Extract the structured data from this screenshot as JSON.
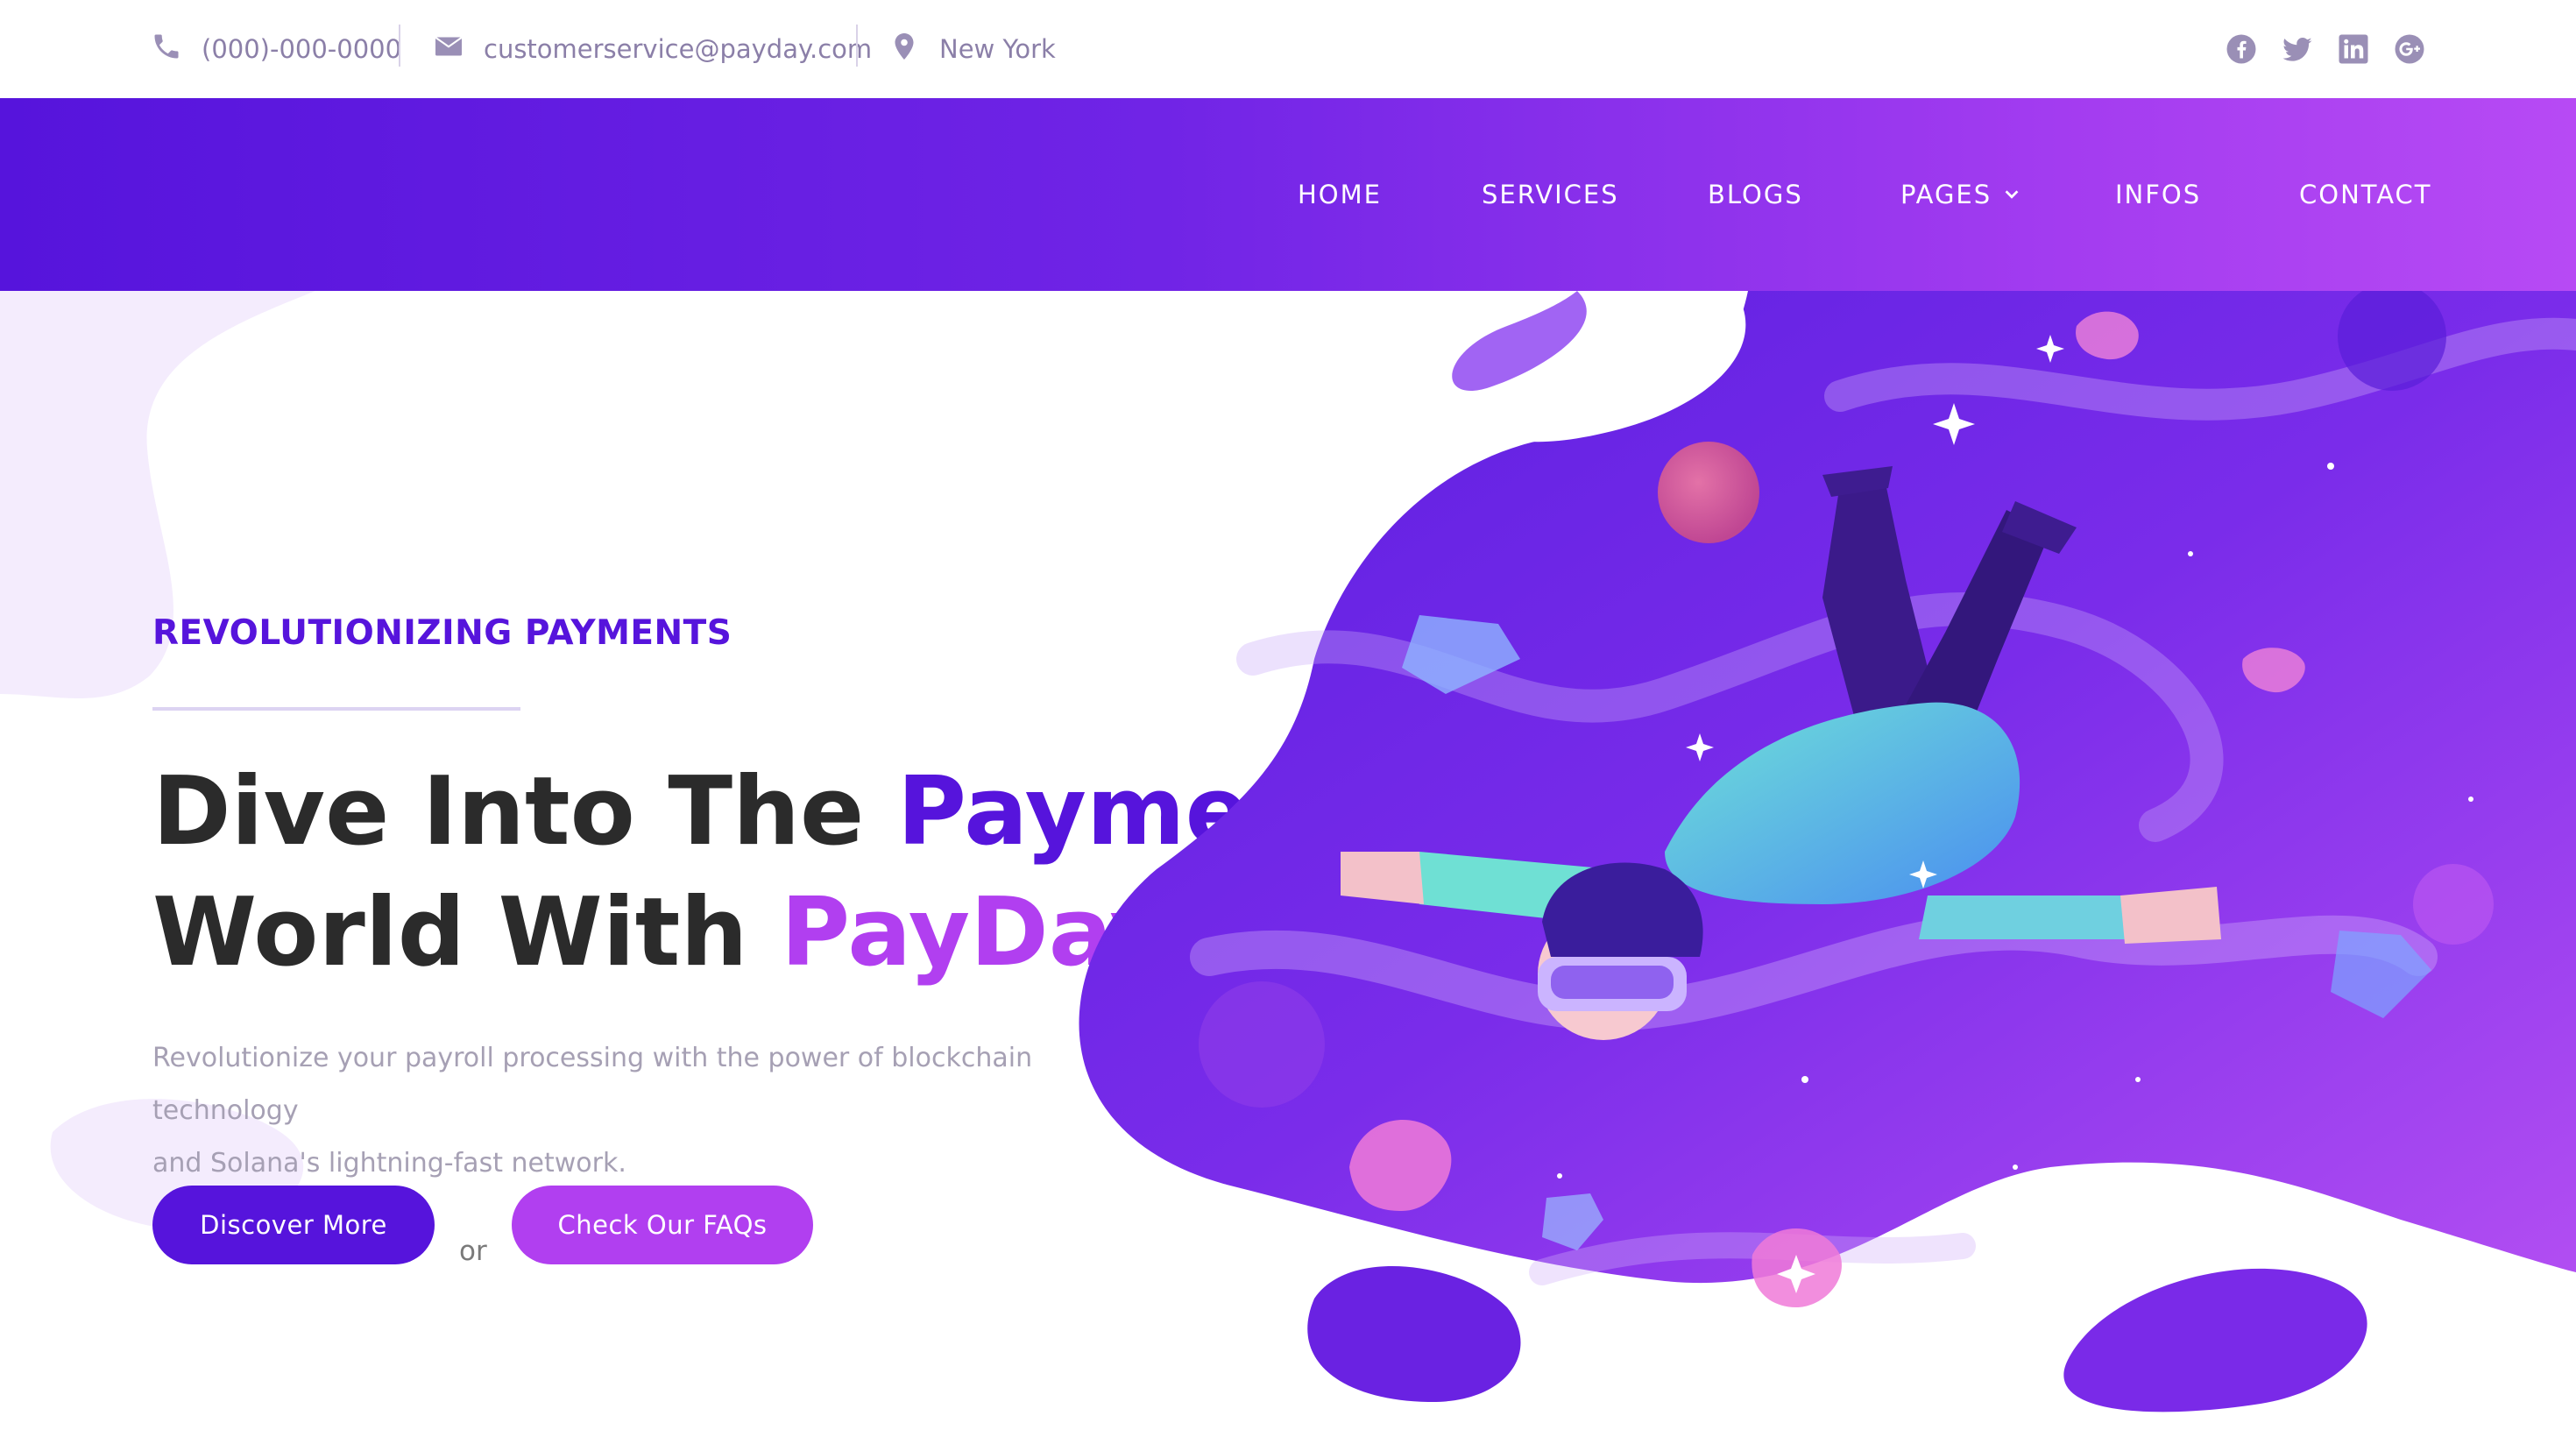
{
  "topbar": {
    "phone": "(000)-000-0000",
    "email": "customerservice@payday.com",
    "location": "New York",
    "icons": {
      "phone": "phone-icon",
      "email": "envelope-icon",
      "location": "map-pin-icon"
    },
    "socials": [
      "facebook-icon",
      "twitter-icon",
      "linkedin-icon",
      "google-plus-icon"
    ]
  },
  "nav": {
    "items": [
      "HOME",
      "SERVICES",
      "BLOGS",
      "PAGES",
      "INFOS",
      "CONTACT"
    ],
    "dropdown_icon": "chevron-down-icon"
  },
  "hero": {
    "eyebrow": "REVOLUTIONIZING PAYMENTS",
    "headline_part1": "Dive Into The ",
    "headline_accent1": "Payments",
    "headline_part2": "World With ",
    "headline_accent2": "PayDay",
    "description_line1": "Revolutionize your payroll processing with the power of blockchain technology",
    "description_line2": "and Solana's lightning-fast network.",
    "primary_button": "Discover More",
    "or_text": "or",
    "secondary_button": "Check Our FAQs"
  },
  "colors": {
    "brand_primary": "#5614dc",
    "brand_secondary": "#b13ff0",
    "nav_gradient_start": "#5614dc",
    "nav_gradient_end": "#b74af4",
    "heading": "#2b2b2b",
    "muted_text": "#a6a0b4"
  }
}
